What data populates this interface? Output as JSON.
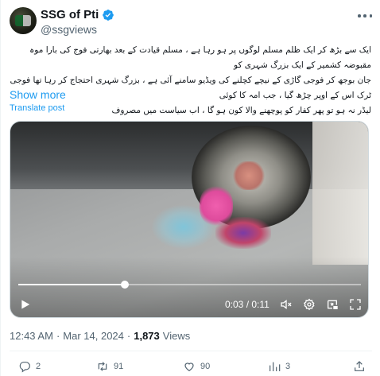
{
  "author": {
    "display_name": "SSG of Pti",
    "handle": "@ssgviews",
    "verified": true
  },
  "tweet": {
    "text_lines": [
      "ایک سے بڑھ کر ایک ظلم مسلم لوگوں پر ہو رہا ہے ، مسلم قیادت کے بعد بھارتی فوج کی بارا موہ مقبوضہ کشمیر کے ایک بزرگ شہری کو",
      "جان بوجھ کر فوجی گاڑی کے نیچے کچلنے کی ویڈیو سامنے آئی ہے ، بزرگ شہری احتجاج کر رہا تھا فوجی ٹرک اس کے اوپر چڑھ گیا ، جب امہ کا کوئی",
      "لیڈر نہ ہو تو پھر کفار کو پوچھنے والا کون ہو گا ، اب سیاست میں مصروف"
    ],
    "show_more": "Show more",
    "translate": "Translate post"
  },
  "video": {
    "current_time": "0:03",
    "duration": "0:11",
    "time_separator": " / ",
    "progress_fraction": 0.31
  },
  "meta": {
    "time": "12:43 AM",
    "date": "Mar 14, 2024",
    "views_count": "1,873",
    "views_label": "Views"
  },
  "actions": {
    "replies": "2",
    "reposts": "91",
    "likes": "90",
    "views": "3"
  },
  "colors": {
    "accent": "#1d9bf0",
    "muted": "#536471",
    "text": "#0f1419"
  },
  "icons": [
    "verified-badge-icon",
    "more-icon",
    "play-icon",
    "mute-icon",
    "settings-icon",
    "pip-icon",
    "fullscreen-icon",
    "reply-icon",
    "repost-icon",
    "like-icon",
    "views-icon",
    "share-icon"
  ]
}
